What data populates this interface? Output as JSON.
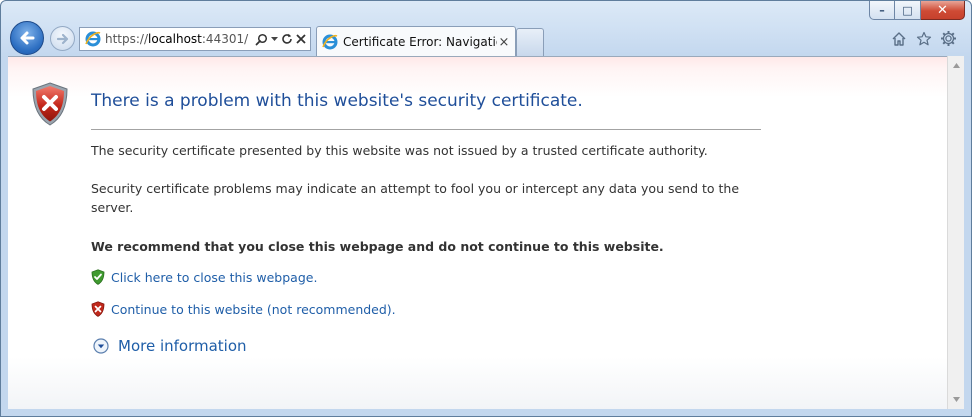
{
  "browser": {
    "address": {
      "protocol": "https://",
      "host": "localhost",
      "port": ":44301/"
    },
    "tab": {
      "title": "Certificate Error: Navigation...",
      "close_glyph": "×"
    },
    "window_controls": {
      "minimize": "–",
      "maximize": "□",
      "close": "✕"
    },
    "icons": [
      "back-arrow-icon",
      "forward-arrow-icon",
      "ie-logo-icon",
      "search-icon",
      "dropdown-icon",
      "refresh-icon",
      "stop-icon",
      "home-icon",
      "favorites-star-icon",
      "settings-gear-icon"
    ]
  },
  "page": {
    "title": "There is a problem with this website's security certificate.",
    "paragraph1": "The security certificate presented by this website was not issued by a trusted certificate authority.",
    "paragraph2": "Security certificate problems may indicate an attempt to fool you or intercept any data you send to the server.",
    "recommendation": "We recommend that you close this webpage and do not continue to this website.",
    "close_link": "Click here to close this webpage.",
    "continue_link": "Continue to this website (not recommended).",
    "more_info": "More information"
  },
  "colors": {
    "title_blue": "#1f4e99",
    "link_blue": "#1f5ea8",
    "shield_red": "#c0281b",
    "shield_green": "#3f9a2f"
  }
}
